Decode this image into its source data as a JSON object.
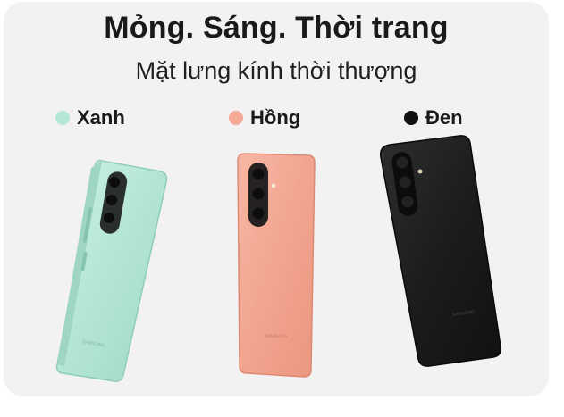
{
  "banner": {
    "title": "Mỏng. Sáng. Thời trang",
    "subtitle": "Mặt lưng kính thời thượng"
  },
  "colors": [
    {
      "label": "Xanh",
      "swatch": "#b5e6d6",
      "body": "#b9e9da"
    },
    {
      "label": "Hồng",
      "swatch": "#f4a995",
      "body": "#f3a894"
    },
    {
      "label": "Đen",
      "swatch": "#111111",
      "body": "#1e1e1e"
    }
  ],
  "brand_mark": "SAMSUNG"
}
